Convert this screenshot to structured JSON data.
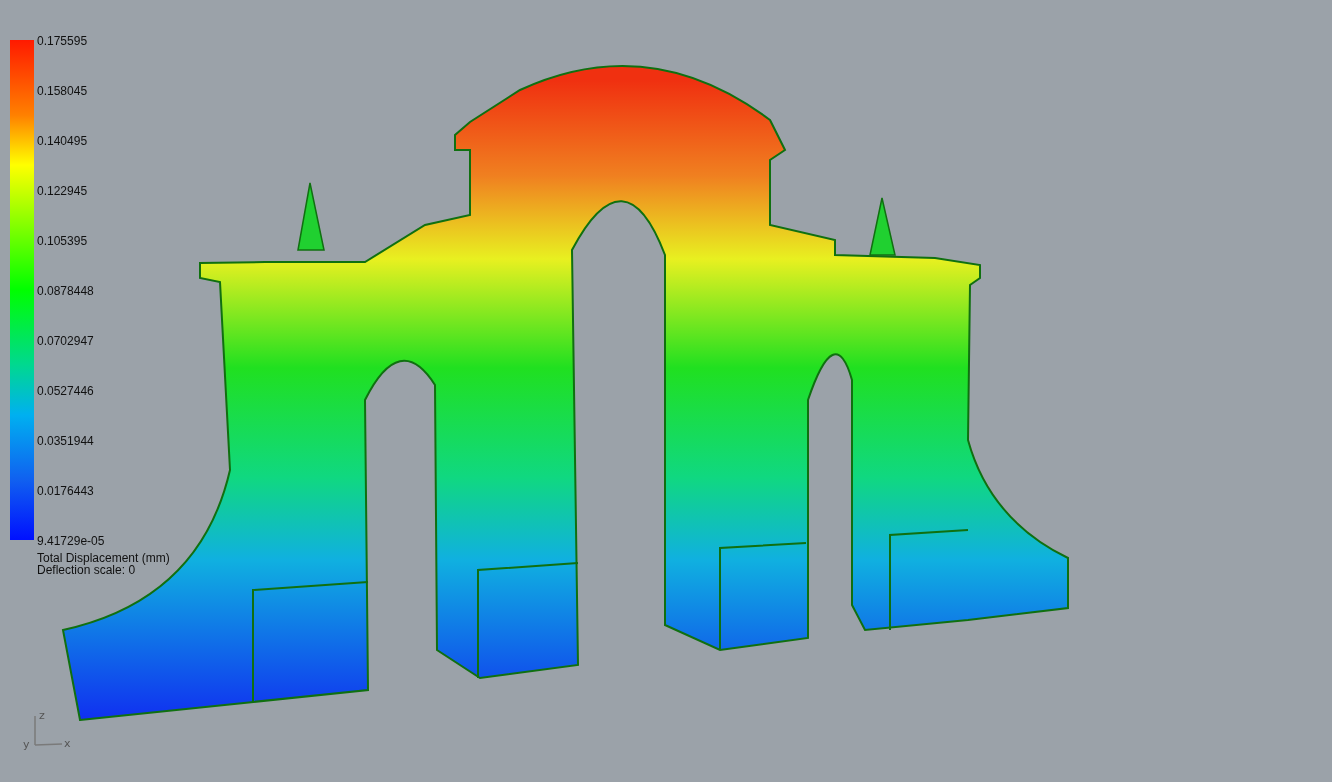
{
  "legend": {
    "labels": [
      "0.175595",
      "0.158045",
      "0.140495",
      "0.122945",
      "0.105395",
      "0.0878448",
      "0.0702947",
      "0.0527446",
      "0.0351944",
      "0.0176443",
      "9.41729e-05"
    ],
    "caption": "Total Displacement (mm)",
    "deflection": "Deflection scale: 0"
  },
  "axes": {
    "x": "x",
    "y": "y",
    "z": "z"
  }
}
